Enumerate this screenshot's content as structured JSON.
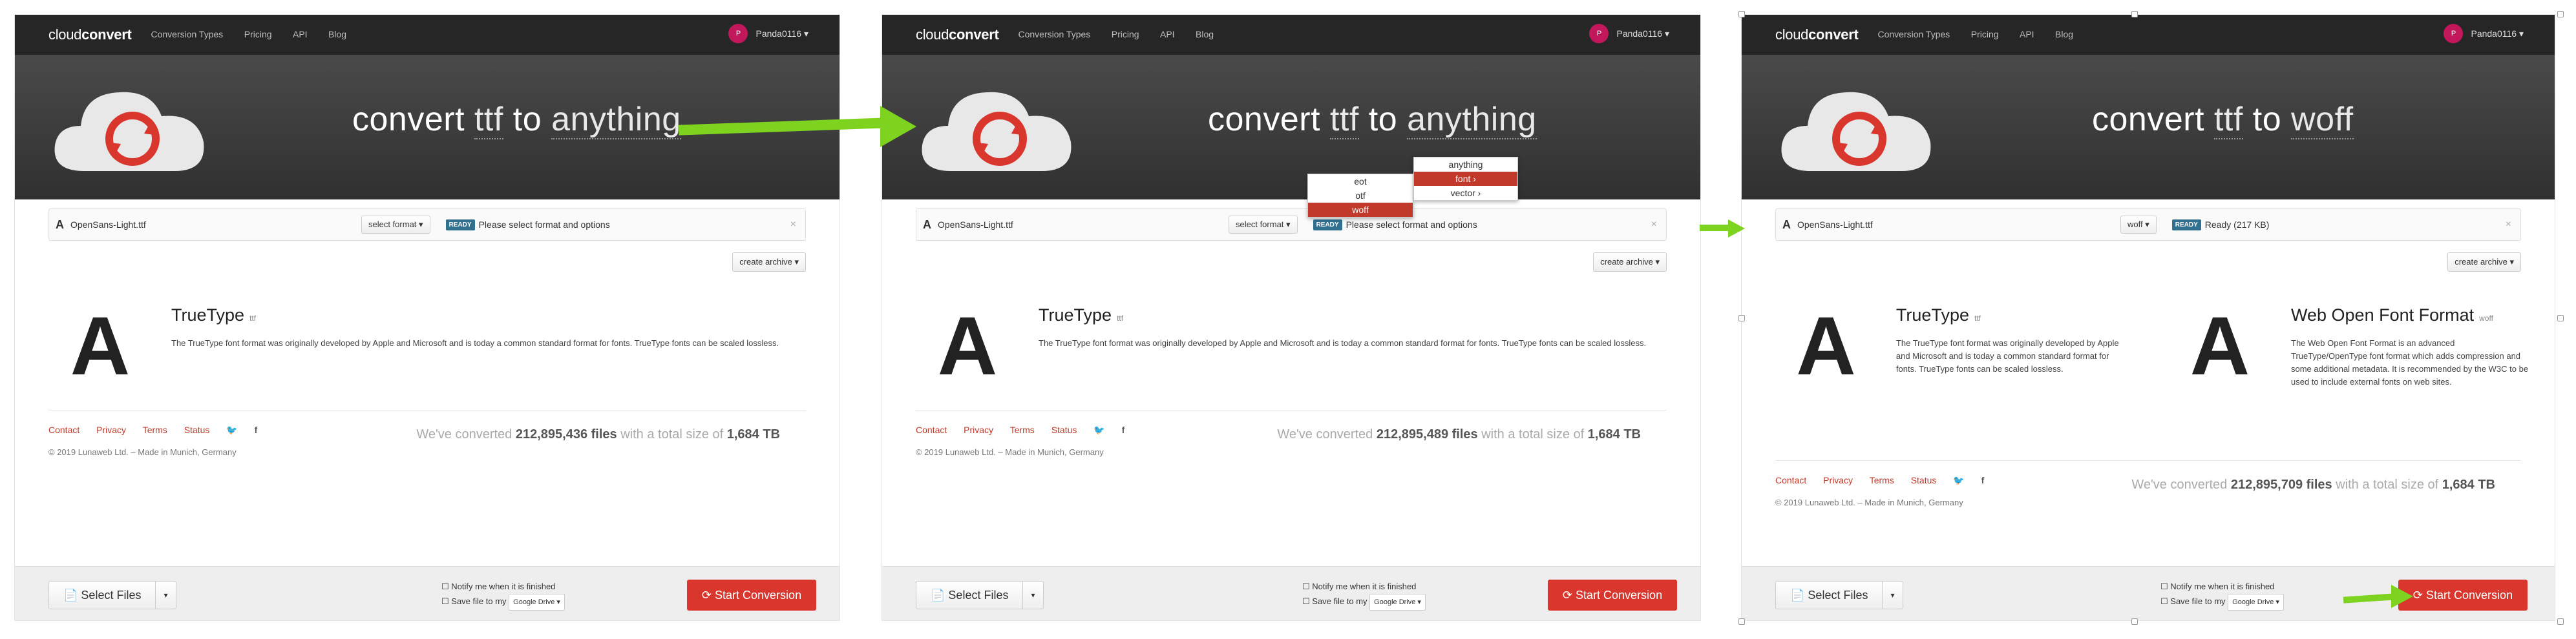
{
  "app": {
    "logo_light": "cloud",
    "logo_bold": "convert",
    "nav": [
      "Conversion Types",
      "Pricing",
      "API",
      "Blog"
    ],
    "user": "Panda0116 ▾",
    "avatar_initials": "P"
  },
  "panels": [
    {
      "headline": {
        "pre": "convert ",
        "from": "ttf",
        "mid": " to ",
        "to": "anything"
      },
      "file": {
        "name": "OpenSans-Light.ttf",
        "format_btn": "select format ▾",
        "badge": "READY",
        "status": "Please select format and options"
      },
      "archive": "create archive ▾",
      "desc": {
        "title": "TrueType",
        "ext": "ttf",
        "body": "The TrueType font format was originally developed by Apple and Microsoft and is today a common standard format for fonts.  TrueType fonts can be scaled lossless."
      },
      "footer": {
        "links": [
          "Contact",
          "Privacy",
          "Terms",
          "Status"
        ],
        "copy": "© 2019 Lunaweb Ltd. – Made in Munich, Germany"
      },
      "stats": {
        "pre": "We've converted ",
        "files": "212,895,436",
        "mid1": " files",
        "mid2": " with a total size of ",
        "size": "1,684 TB"
      }
    },
    {
      "headline": {
        "pre": "convert ",
        "from": "ttf",
        "mid": " to ",
        "to": "anything"
      },
      "file": {
        "name": "OpenSans-Light.ttf",
        "format_btn": "select format ▾",
        "badge": "READY",
        "status": "Please select format and options"
      },
      "archive": "create archive ▾",
      "desc": {
        "title": "TrueType",
        "ext": "ttf",
        "body": "The TrueType font format was originally developed by Apple and Microsoft and is today a common standard format for fonts.  TrueType fonts can be scaled lossless."
      },
      "footer": {
        "links": [
          "Contact",
          "Privacy",
          "Terms",
          "Status"
        ],
        "copy": "© 2019 Lunaweb Ltd. – Made in Munich, Germany"
      },
      "stats": {
        "pre": "We've converted ",
        "files": "212,895,489",
        "mid1": " files",
        "mid2": " with a total size of ",
        "size": "1,684 TB"
      },
      "menu_categories": [
        "anything",
        "font",
        "vector"
      ],
      "menu_formats": [
        "eot",
        "otf",
        "woff"
      ]
    },
    {
      "headline": {
        "pre": "convert ",
        "from": "ttf",
        "mid": " to ",
        "to": "woff"
      },
      "file": {
        "name": "OpenSans-Light.ttf",
        "format_btn": "woff ▾",
        "badge": "READY",
        "status": "Ready (217 KB)"
      },
      "archive": "create archive ▾",
      "desc": {
        "title": "TrueType",
        "ext": "ttf",
        "body": "The TrueType font format was originally developed by Apple and Microsoft and is today a common standard format for fonts.  TrueType fonts can be scaled lossless."
      },
      "desc2": {
        "title": "Web Open Font Format",
        "ext": "woff",
        "body": "The Web Open Font Format is an advanced TrueType/OpenType font format which adds compression and some additional metadata. It is recommended by the W3C to be used to include external fonts on web sites."
      },
      "footer": {
        "links": [
          "Contact",
          "Privacy",
          "Terms",
          "Status"
        ],
        "copy": "© 2019 Lunaweb Ltd. – Made in Munich, Germany"
      },
      "stats": {
        "pre": "We've converted ",
        "files": "212,895,709",
        "mid1": " files",
        "mid2": " with a total size of ",
        "size": "1,684 TB"
      }
    }
  ],
  "bottom": {
    "select_files": "Select Files",
    "notify": "Notify me when it is finished",
    "save_to": "Save file to my",
    "drive": "Google Drive ▾",
    "start": "Start Conversion"
  },
  "colors": {
    "accent": "#d9372d",
    "arrow": "#7ed321",
    "topbar": "#262626",
    "badge": "#31708f"
  }
}
